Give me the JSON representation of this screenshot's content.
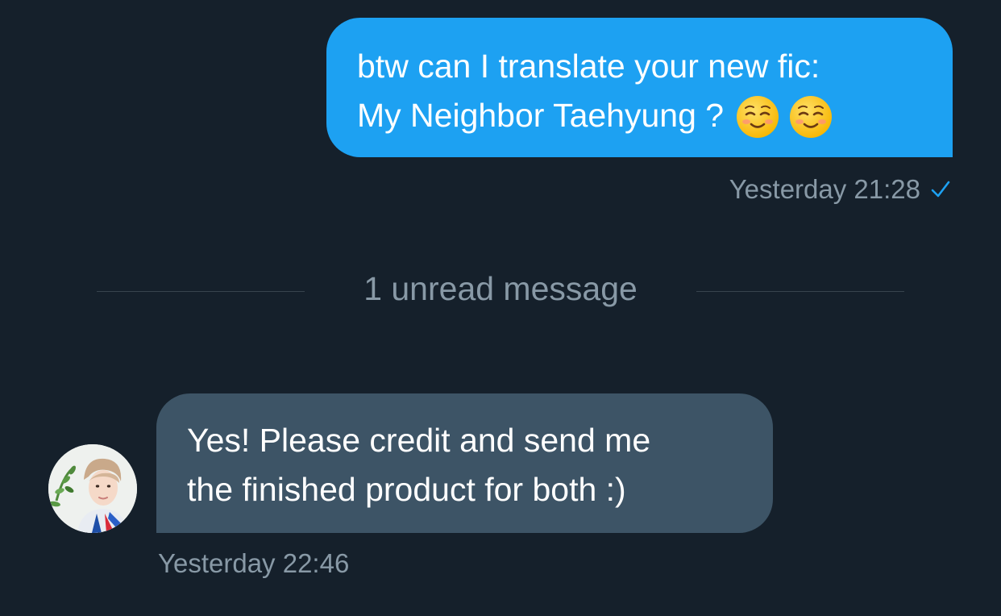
{
  "colors": {
    "background": "#15202b",
    "outgoing_bubble": "#1da1f2",
    "incoming_bubble": "#3d5466",
    "muted_text": "#8899a6",
    "divider_line": "#38444d",
    "check": "#1da1f2"
  },
  "outgoing_message": {
    "line1": "btw can I translate your new fic:",
    "line2": "My Neighbor Taehyung ?",
    "emoji_icons": [
      "smiling-face-emoji-icon",
      "smiling-face-emoji-icon"
    ],
    "timestamp": "Yesterday 21:28",
    "status_icon": "check-icon"
  },
  "unread_divider": {
    "label": "1 unread message"
  },
  "incoming_message": {
    "avatar_icon": "avatar",
    "line1": "Yes! Please credit and send me",
    "line2": "the finished product for both :)",
    "timestamp": "Yesterday 22:46"
  }
}
